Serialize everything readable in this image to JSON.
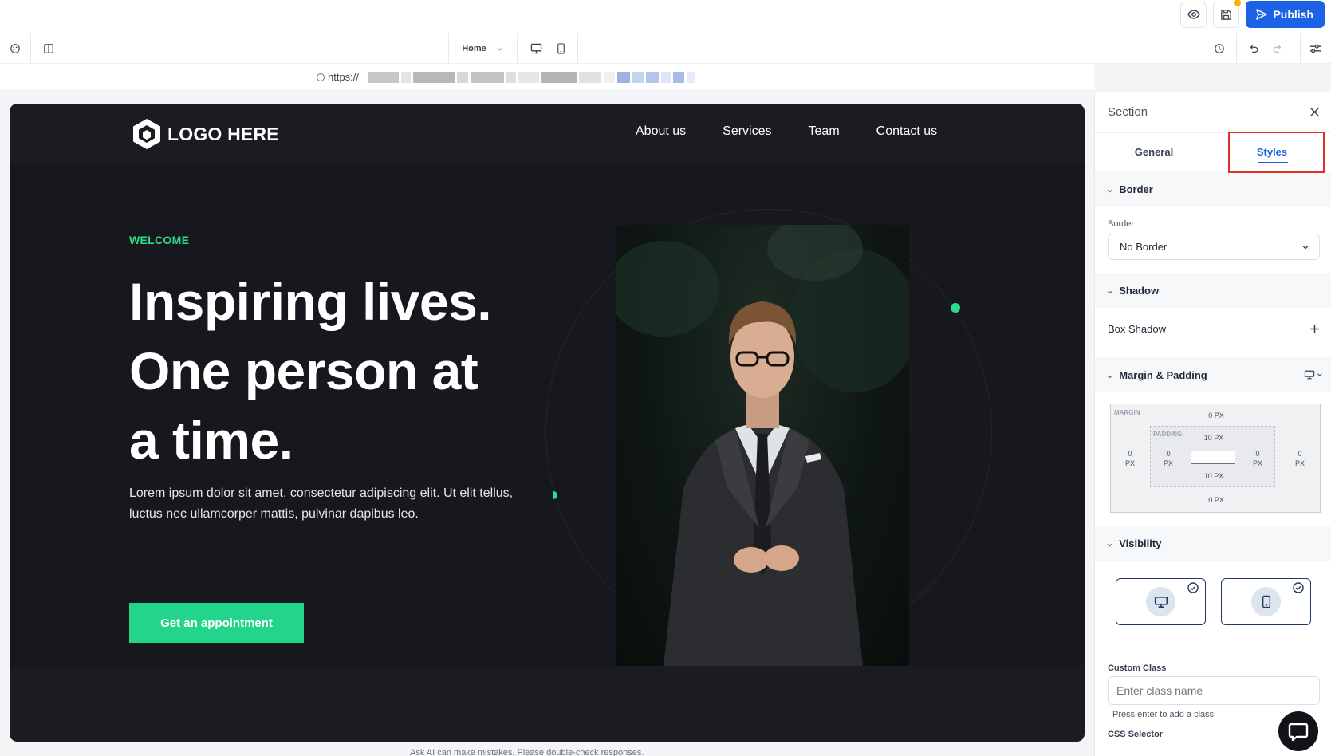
{
  "topbar": {
    "publish_label": "Publish",
    "icons": [
      "eye-icon",
      "save-icon",
      "send-icon"
    ]
  },
  "toolbar": {
    "page_selected": "Home",
    "icons": [
      "palette-icon",
      "layout-toggle-icon",
      "desktop-view-icon",
      "mobile-view-icon",
      "history-icon",
      "undo-icon",
      "redo-icon",
      "settings-sliders-icon"
    ]
  },
  "urlbar": {
    "prefix": "https://"
  },
  "site": {
    "logo_text": "LOGO HERE",
    "nav": [
      "About us",
      "Services",
      "Team",
      "Contact us"
    ],
    "welcome": "WELCOME",
    "headline": "Inspiring lives. One person at a time.",
    "lead": "Lorem ipsum dolor sit amet, consectetur adipiscing elit. Ut elit tellus, luctus nec ullamcorper mattis, pulvinar dapibus leo.",
    "cta": "Get an appointment"
  },
  "disclaimer": "Ask AI can make mistakes. Please double-check responses.",
  "panel": {
    "title": "Section",
    "tabs": [
      "General",
      "Styles"
    ],
    "active_tab": "Styles",
    "border": {
      "section": "Border",
      "label": "Border",
      "value": "No Border"
    },
    "shadow": {
      "section": "Shadow",
      "box_shadow_label": "Box Shadow"
    },
    "spacing": {
      "section": "Margin & Padding",
      "margin_label": "MARGIN",
      "padding_label": "PADDING",
      "margin_top": "0 PX",
      "margin_bottom": "0 PX",
      "margin_left_value": "0",
      "margin_right_value": "0",
      "padding_top": "10 PX",
      "padding_bottom": "10 PX",
      "padding_left_value": "0",
      "padding_right_value": "0",
      "unit": "PX"
    },
    "visibility": {
      "section": "Visibility",
      "desktop_visible": true,
      "mobile_visible": true
    },
    "custom_class": {
      "label": "Custom Class",
      "placeholder": "Enter class name",
      "hint": "Press enter to add a class"
    },
    "css_selector_label": "CSS Selector"
  },
  "colors": {
    "accent_blue": "#1b62e6",
    "brand_green": "#23d58a",
    "highlight_red": "#e0302a",
    "canvas_bg": "#17181d"
  }
}
